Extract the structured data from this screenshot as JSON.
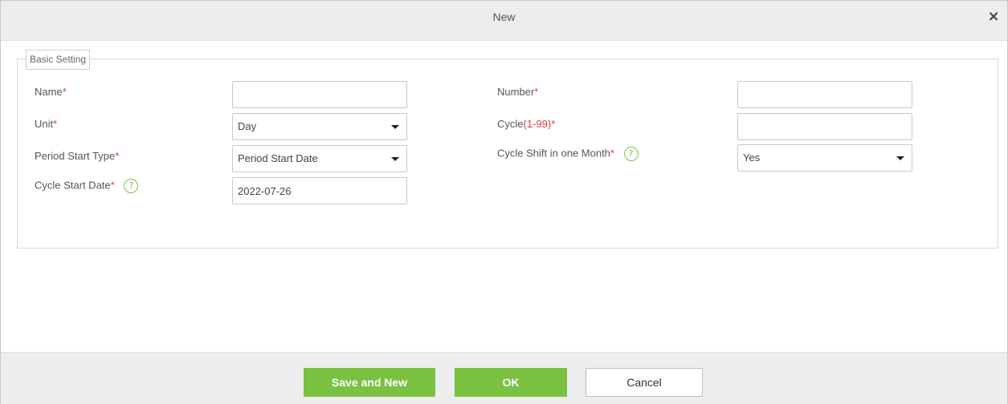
{
  "dialog": {
    "title": "New",
    "close_symbol": "×"
  },
  "section": {
    "legend": "Basic Setting"
  },
  "fields": {
    "name": {
      "label": "Name",
      "required": "*",
      "value": ""
    },
    "number": {
      "label": "Number",
      "required": "*",
      "value": ""
    },
    "unit": {
      "label": "Unit",
      "required": "*",
      "value": "Day"
    },
    "cycle": {
      "label": "Cycle",
      "range": "(1-99)",
      "required": "*",
      "value": ""
    },
    "period_start_type": {
      "label": "Period Start Type",
      "required": "*",
      "value": "Period Start Date"
    },
    "cycle_shift": {
      "label": "Cycle Shift in one Month",
      "required": "*",
      "value": "Yes"
    },
    "cycle_start_date": {
      "label": "Cycle Start Date",
      "required": "*",
      "value": "2022-07-26"
    }
  },
  "help_glyph": "?",
  "buttons": {
    "save_and_new": "Save and New",
    "ok": "OK",
    "cancel": "Cancel"
  },
  "colors": {
    "accent_green": "#7ac142",
    "required_red": "#e23b3b",
    "header_gray": "#ededed"
  }
}
